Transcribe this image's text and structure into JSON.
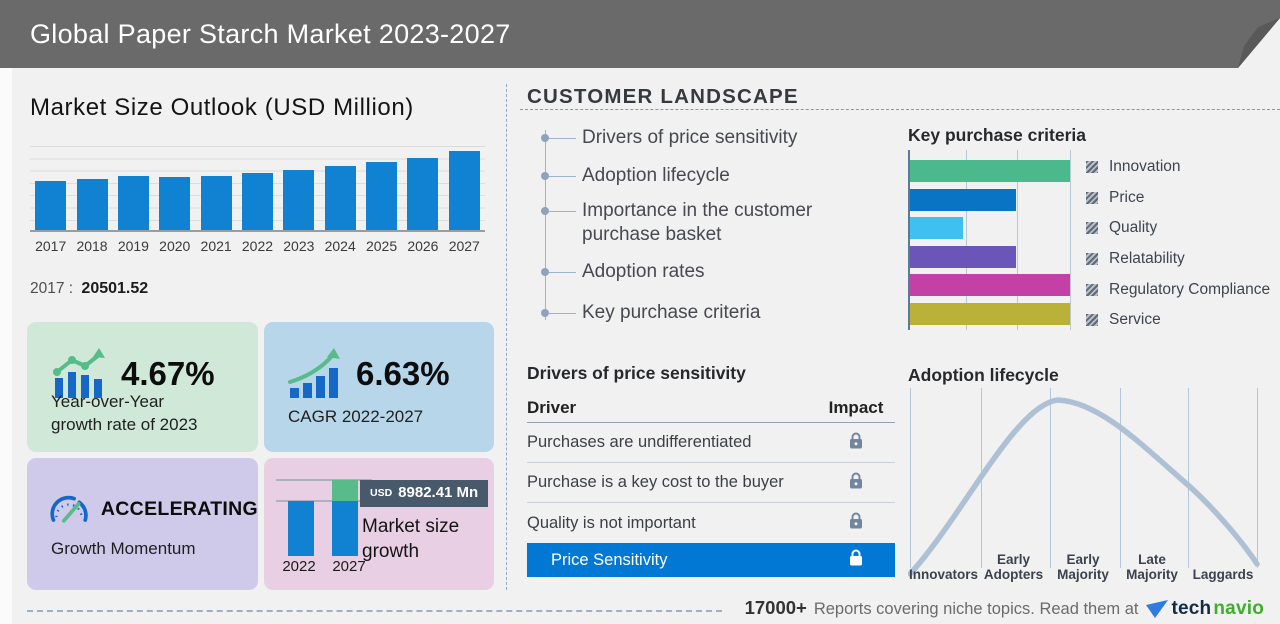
{
  "header": {
    "title": "Global Paper Starch Market 2023-2027",
    "bg_color": "#6a6a6a"
  },
  "market_outlook": {
    "title": "Market Size Outlook (USD Million)",
    "callout_year": "2017",
    "callout_sep": ":",
    "callout_value": "20501.52"
  },
  "cards": {
    "yoy": {
      "value": "4.67%",
      "label_line1": "Year-over-Year",
      "label_line2": "growth rate of 2023",
      "bg": "#cfe8d8"
    },
    "cagr": {
      "value": "6.63%",
      "label": "CAGR 2022-2027",
      "bg": "#b7d6ea"
    },
    "momentum": {
      "value": "ACCELERATING",
      "label": "Growth Momentum",
      "bg": "#cfc9ea"
    },
    "growth": {
      "badge_currency": "USD",
      "badge_value": "8982.41 Mn",
      "label_line1": "Market size",
      "label_line2": "growth",
      "bg": "#e9cfe3",
      "badge_bg": "#47596b"
    }
  },
  "customer_landscape": {
    "title": "CUSTOMER LANDSCAPE",
    "items": [
      "Drivers of price sensitivity",
      "Adoption lifecycle",
      "Importance in the customer purchase basket",
      "Adoption rates",
      "Key purchase criteria"
    ]
  },
  "drivers_table": {
    "title": "Drivers of price sensitivity",
    "columns": [
      "Driver",
      "Impact"
    ],
    "rows": [
      "Purchases are undifferentiated",
      "Purchase is a key cost to the buyer",
      "Quality is not important"
    ],
    "highlight_row": "Price Sensitivity",
    "highlight_bg": "#0078d4",
    "impact_icon": "lock-icon"
  },
  "footer": {
    "count": "17000+",
    "message": "Reports covering niche topics. Read them at",
    "brand_part1": "tech",
    "brand_part2": "navio"
  },
  "chart_data": [
    {
      "id": "market_size_outlook",
      "type": "bar",
      "title": "Market Size Outlook (USD Million)",
      "unit": "USD Million",
      "categories": [
        "2017",
        "2018",
        "2019",
        "2020",
        "2021",
        "2022",
        "2023",
        "2024",
        "2025",
        "2026",
        "2027"
      ],
      "values": [
        20501.52,
        21350,
        22630,
        22210,
        22630,
        23903,
        25020,
        26680,
        28450,
        30340,
        32885.41
      ],
      "labeled_point": {
        "category": "2017",
        "value": 20501.52
      },
      "bar_color": "#1181d2",
      "ylim": [
        0,
        36000
      ],
      "grid": true,
      "legend": "none"
    },
    {
      "id": "key_purchase_criteria",
      "type": "bar",
      "orientation": "horizontal",
      "title": "Key purchase criteria",
      "categories": [
        "Innovation",
        "Price",
        "Quality",
        "Relatability",
        "Regulatory Compliance",
        "Service"
      ],
      "values": [
        100,
        66,
        33,
        66,
        100,
        100
      ],
      "colors": [
        "#4cb98c",
        "#0a74c4",
        "#3ec0f0",
        "#6a55b8",
        "#c341a5",
        "#b9b138"
      ],
      "xlim": [
        0,
        100
      ],
      "grid": true,
      "legend_position": "right"
    },
    {
      "id": "adoption_lifecycle",
      "type": "area",
      "title": "Adoption lifecycle",
      "shape": "bell curve peaking over Early Majority",
      "categories": [
        "Innovators",
        "Early Adopters",
        "Early Majority",
        "Late Majority",
        "Laggards"
      ],
      "curve_color": "#aec0d3",
      "grid": true
    },
    {
      "id": "market_size_growth",
      "type": "bar",
      "title": "Market size growth",
      "categories": [
        "2022",
        "2027"
      ],
      "values": [
        23903,
        32885.41
      ],
      "growth_value": "USD 8982.41 Mn",
      "colors": {
        "base": "#1181d2",
        "growth": "#57bb8a"
      }
    }
  ]
}
